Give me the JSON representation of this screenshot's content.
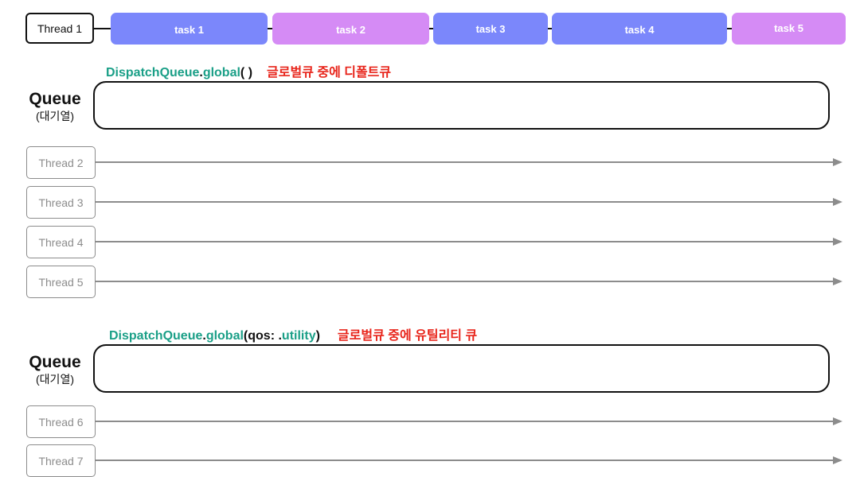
{
  "colors": {
    "task_blue": "#7b87fb",
    "task_purple": "#d58bf5",
    "teal": "#1a9f87",
    "note_red": "#e8241a",
    "thread_gray": "#8c8c8c"
  },
  "main_thread": {
    "label": "Thread 1",
    "tasks": [
      {
        "label": "task 1",
        "color": "blue"
      },
      {
        "label": "task 2",
        "color": "purple"
      },
      {
        "label": "task 3",
        "color": "blue"
      },
      {
        "label": "task 4",
        "color": "blue"
      },
      {
        "label": "task 5",
        "color": "purple"
      }
    ]
  },
  "default_queue": {
    "api_prefix": "DispatchQueue",
    "api_dot": ".",
    "api_method": "global",
    "api_args": "( )",
    "note": "글로벌큐 중에 디폴트큐",
    "queue_title": "Queue",
    "queue_sub": "(대기열)",
    "threads": [
      "Thread 2",
      "Thread 3",
      "Thread 4",
      "Thread 5"
    ]
  },
  "utility_queue": {
    "api_prefix": "DispatchQueue",
    "api_dot": ".",
    "api_method": "global",
    "api_args_open": "(qos: .",
    "api_qos": "utility",
    "api_args_close": ")",
    "note": "글로벌큐 중에 유틸리티 큐",
    "queue_title": "Queue",
    "queue_sub": "(대기열)",
    "threads": [
      "Thread 6",
      "Thread 7"
    ]
  }
}
